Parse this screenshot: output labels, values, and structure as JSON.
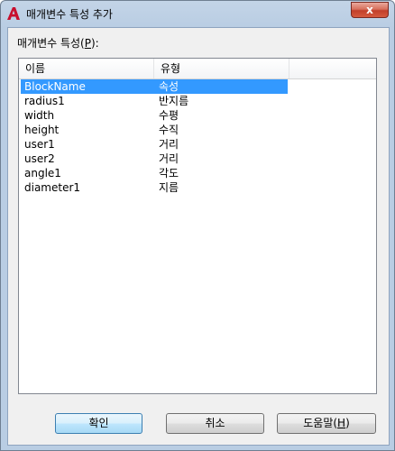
{
  "window": {
    "title": "매개변수 특성 추가",
    "close_label": "x"
  },
  "list": {
    "label_prefix": "매개변수 특성(",
    "label_accel": "P",
    "label_suffix": "):",
    "columns": [
      "이름",
      "유형"
    ],
    "rows": [
      {
        "name": "BlockName",
        "type": "속성"
      },
      {
        "name": "radius1",
        "type": "반지름"
      },
      {
        "name": "width",
        "type": "수평"
      },
      {
        "name": "height",
        "type": "수직"
      },
      {
        "name": "user1",
        "type": "거리"
      },
      {
        "name": "user2",
        "type": "거리"
      },
      {
        "name": "angle1",
        "type": "각도"
      },
      {
        "name": "diameter1",
        "type": "지름"
      }
    ],
    "selected_index": 0
  },
  "buttons": {
    "ok_label": "확인",
    "cancel_label": "취소",
    "help_prefix": "도움말(",
    "help_accel": "H",
    "help_suffix": ")"
  },
  "colors": {
    "selection": "#3399ff",
    "app_icon": "#c8102e"
  },
  "icons": {
    "app": "autocad-a-icon",
    "close": "close-icon"
  }
}
